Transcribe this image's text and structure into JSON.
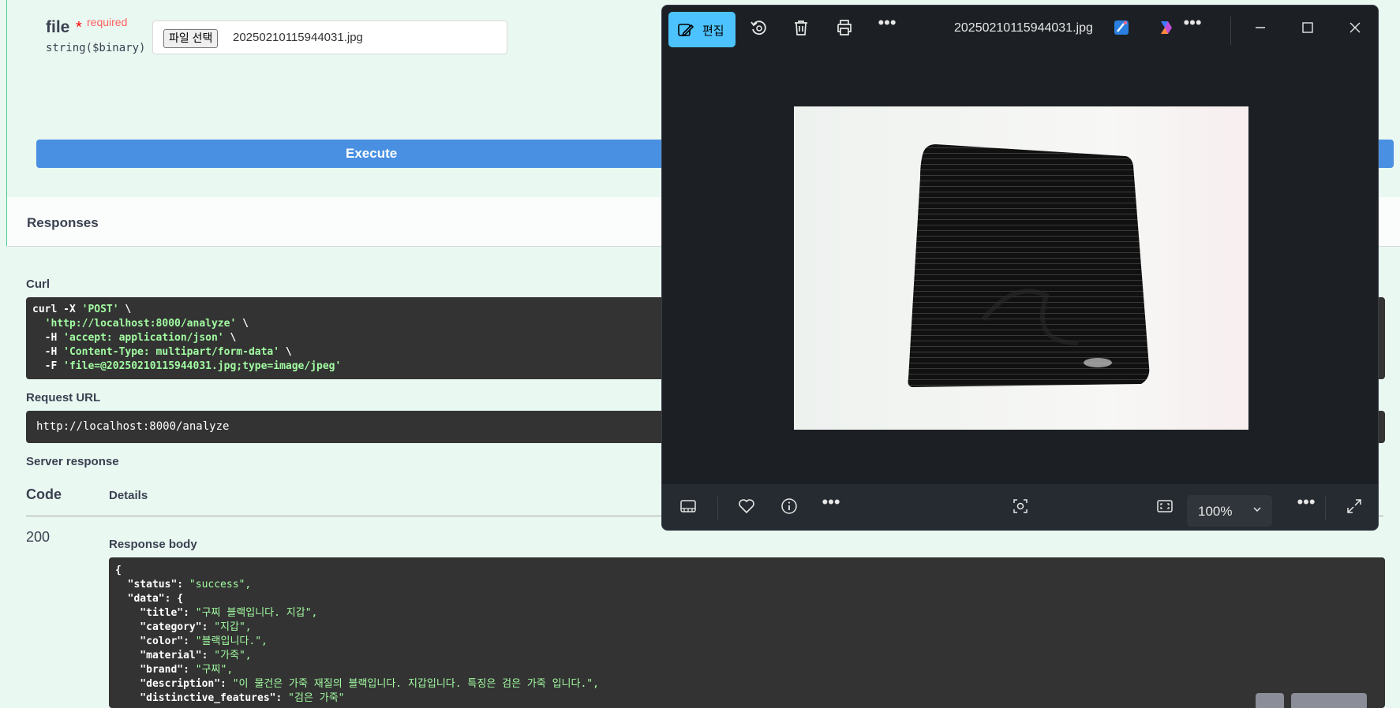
{
  "param": {
    "name": "file",
    "star": "*",
    "required": "required",
    "type": "string($binary)",
    "file_button": "파일 선택",
    "file_name": "20250210115944031.jpg"
  },
  "execute_label": "Execute",
  "responses": {
    "title": "Responses",
    "curl_label": "Curl",
    "curl_lines": [
      [
        "curl -X ",
        "'POST'",
        " \\"
      ],
      [
        "  ",
        "'http://localhost:8000/analyze'",
        " \\"
      ],
      [
        "  -H ",
        "'accept: application/json'",
        " \\"
      ],
      [
        "  -H ",
        "'Content-Type: multipart/form-data'",
        " \\"
      ],
      [
        "  -F ",
        "'file=@20250210115944031.jpg;type=image/jpeg'",
        ""
      ]
    ],
    "request_url_label": "Request URL",
    "request_url": "http://localhost:8000/analyze",
    "server_response_label": "Server response",
    "code_header": "Code",
    "details_header": "Details",
    "code": "200",
    "response_body_label": "Response body",
    "body_lines": [
      [
        "{",
        ""
      ],
      [
        "  \"status\": ",
        "\"success\","
      ],
      [
        "  \"data\": {",
        ""
      ],
      [
        "    \"title\": ",
        "\"구찌 블랙입니다. 지갑\","
      ],
      [
        "    \"category\": ",
        "\"지갑\","
      ],
      [
        "    \"color\": ",
        "\"블랙입니다.\","
      ],
      [
        "    \"material\": ",
        "\"가죽\","
      ],
      [
        "    \"brand\": ",
        "\"구찌\","
      ],
      [
        "    \"description\": ",
        "\"이 물건은 가죽 재질의 블랙입니다. 지갑입니다. 특징은 검은 가죽 입니다.\","
      ],
      [
        "    \"distinctive_features\": ",
        "\"검은 가죽\""
      ]
    ]
  },
  "photo_viewer": {
    "edit_label": "편집",
    "file_title": "20250210115944031.jpg",
    "zoom": "100%",
    "icons": {
      "edit": "edit-icon",
      "rotate": "rotate-icon",
      "delete": "trash-icon",
      "print": "print-icon",
      "more": "more-icon",
      "paint": "paint-icon",
      "copilot": "copilot-icon",
      "minimize": "minimize-icon",
      "maximize": "maximize-icon",
      "close": "close-icon",
      "filmstrip": "filmstrip-icon",
      "favorite": "heart-icon",
      "info": "info-icon",
      "visual_search": "visual-search-icon",
      "fit": "fit-to-window-icon",
      "fullscreen": "fullscreen-icon"
    }
  },
  "colors": {
    "swagger_bg": "#e9f8f1",
    "execute_blue": "#4990e2",
    "code_bg": "#333333",
    "string_green": "#a2fca2",
    "viewer_bg": "#1c2024",
    "edit_accent": "#4cc2ff"
  }
}
